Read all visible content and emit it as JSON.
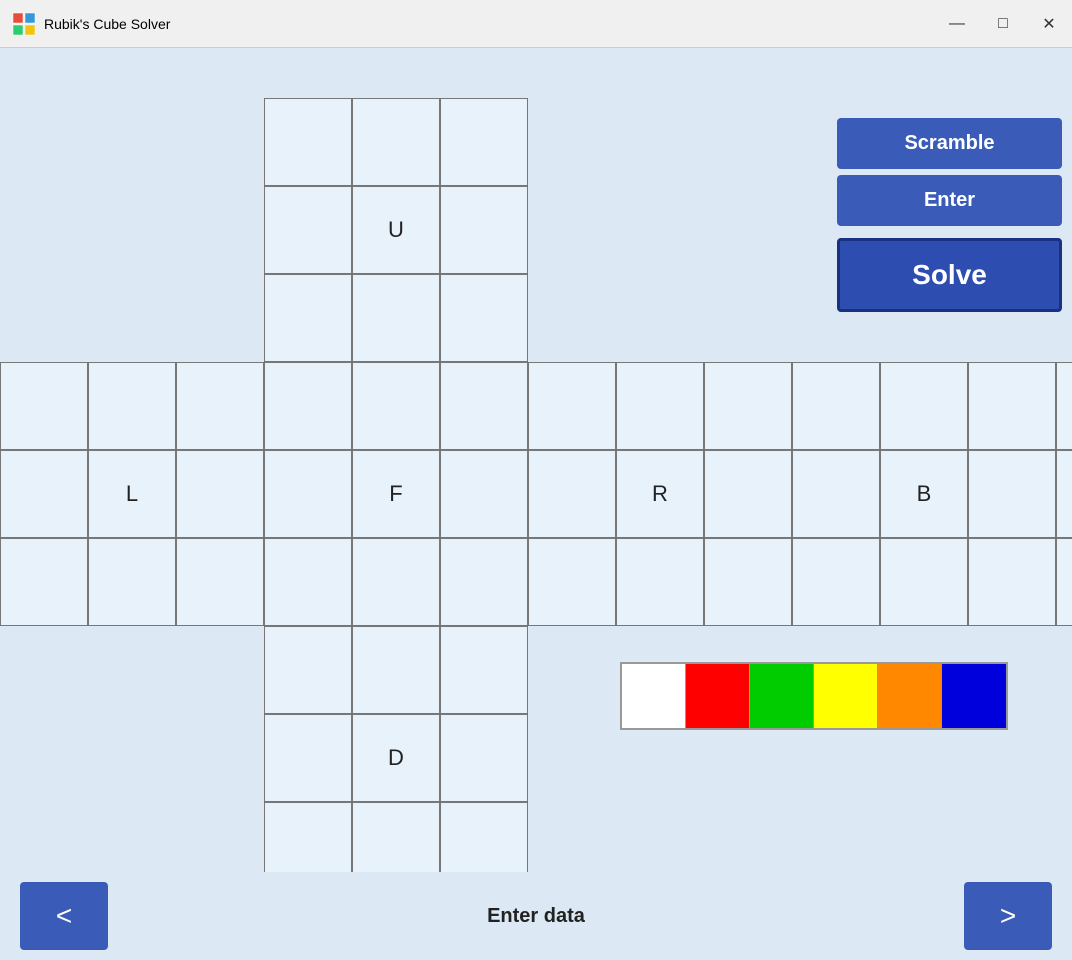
{
  "titleBar": {
    "title": "Rubik's Cube Solver",
    "iconColor": "#e74c3c",
    "minimizeLabel": "—",
    "maximizeLabel": "□",
    "closeLabel": "✕"
  },
  "buttons": {
    "scramble": "Scramble",
    "enter": "Enter",
    "solve": "Solve",
    "prev": "<",
    "next": ">"
  },
  "faces": {
    "U": {
      "label": "U",
      "centerIndex": 4
    },
    "L": {
      "label": "L",
      "centerIndex": 4
    },
    "F": {
      "label": "F",
      "centerIndex": 4
    },
    "R": {
      "label": "R",
      "centerIndex": 4
    },
    "B": {
      "label": "B",
      "centerIndex": 4
    },
    "D": {
      "label": "D",
      "centerIndex": 4
    }
  },
  "colorPalette": [
    {
      "name": "white",
      "hex": "#ffffff"
    },
    {
      "name": "red",
      "hex": "#ff0000"
    },
    {
      "name": "green",
      "hex": "#00cc00"
    },
    {
      "name": "yellow",
      "hex": "#ffff00"
    },
    {
      "name": "orange",
      "hex": "#ff8800"
    },
    {
      "name": "blue",
      "hex": "#0000dd"
    }
  ],
  "bottomBar": {
    "enterDataLabel": "Enter data"
  }
}
